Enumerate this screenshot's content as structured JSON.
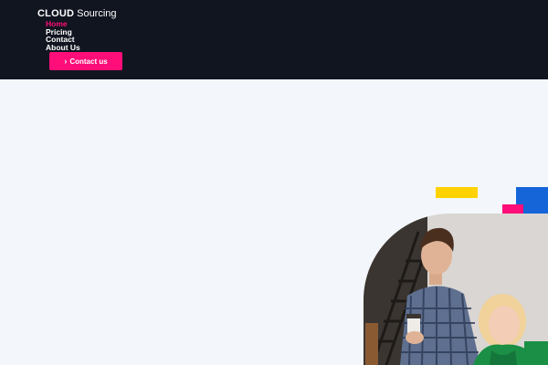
{
  "brand": {
    "bold": "CLOUD",
    "light": "Sourcing"
  },
  "nav": {
    "items": [
      {
        "label": "Home",
        "active": true
      },
      {
        "label": "Pricing"
      },
      {
        "label": "Contact"
      },
      {
        "label": "About Us"
      }
    ]
  },
  "cta": {
    "icon": "chevron-right-icon",
    "label": "Contact us"
  },
  "colors": {
    "header_bg": "#111520",
    "accent": "#ff0d78",
    "page_bg": "#f3f7fc",
    "yellow": "#ffd200",
    "blue": "#1565d8"
  },
  "hero_image": {
    "subject": "two people looking at a screen"
  }
}
